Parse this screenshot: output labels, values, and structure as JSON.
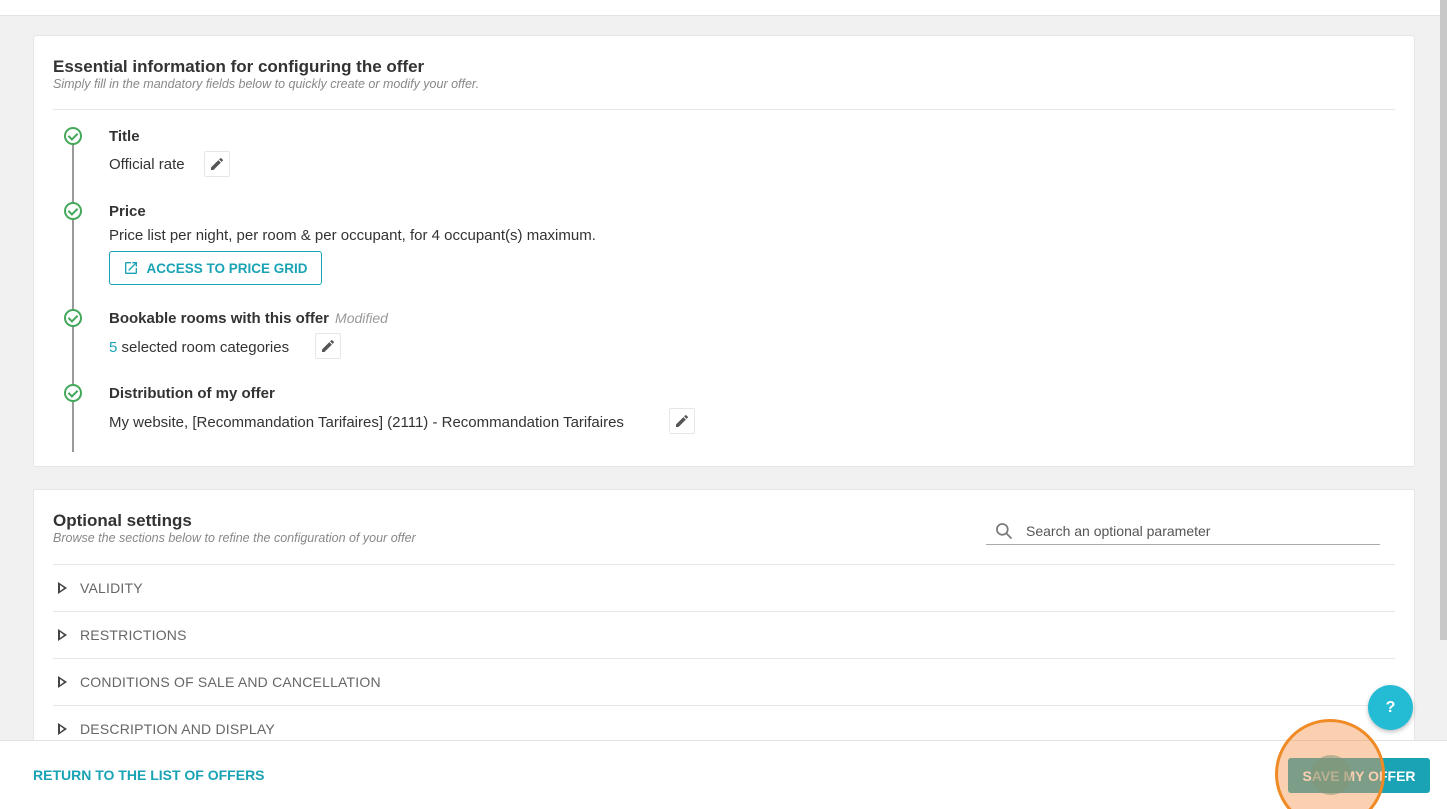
{
  "essential": {
    "title": "Essential information for configuring the offer",
    "subtitle": "Simply fill in the mandatory fields below to quickly create or modify your offer.",
    "steps": [
      {
        "label": "Title",
        "value": "Official rate"
      },
      {
        "label": "Price",
        "value": "Price list per night, per room & per occupant, for 4 occupant(s) maximum.",
        "button": "ACCESS TO PRICE GRID"
      },
      {
        "label": "Bookable rooms with this offer",
        "badge": "Modified",
        "count": "5",
        "value": "selected room categories"
      },
      {
        "label": "Distribution of my offer",
        "value": "My website, [Recommandation Tarifaires] (2111) - Recommandation Tarifaires"
      }
    ]
  },
  "optional": {
    "title": "Optional settings",
    "subtitle": "Browse the sections below to refine the configuration of your offer",
    "search_placeholder": "Search an optional parameter",
    "sections": [
      "VALIDITY",
      "RESTRICTIONS",
      "CONDITIONS OF SALE AND CANCELLATION",
      "DESCRIPTION AND DISPLAY"
    ]
  },
  "footer": {
    "return_label": "RETURN TO THE LIST OF OFFERS",
    "save_label": "SAVE MY OFFER"
  },
  "help": {
    "label": "?"
  },
  "colors": {
    "accent": "#1aa3b4",
    "success": "#43a85a",
    "highlight": "#f08a24"
  }
}
